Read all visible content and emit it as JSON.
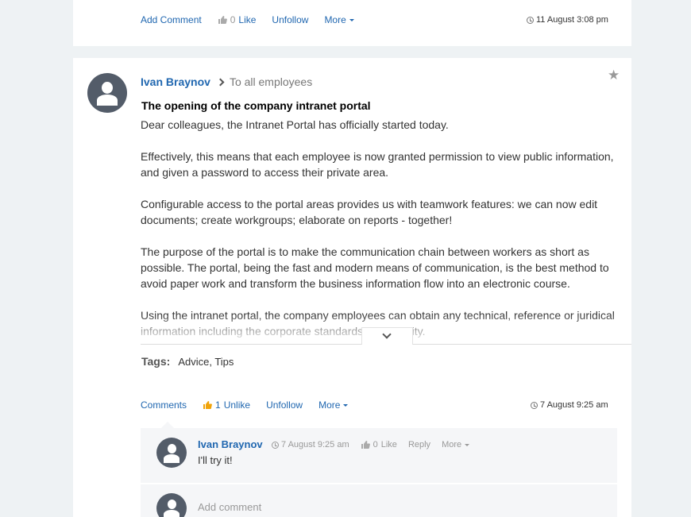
{
  "prev_post": {
    "add_comment": "Add Comment",
    "like_count": "0",
    "like_label": "Like",
    "unfollow": "Unfollow",
    "more": "More",
    "date": "11 August 3:08 pm"
  },
  "post": {
    "author": "Ivan Braynov",
    "recipient": "To all employees",
    "title": "The opening of the company intranet portal",
    "paragraphs": [
      "Dear colleagues, the Intranet Portal has officially started today.",
      "Effectively, this means that each employee is now granted permission to view public information, and given a password to access their private area.",
      "Configurable access to the portal areas provides us with teamwork features: we can now edit documents; create workgroups; elaborate on reports - together!",
      "The purpose of the portal is to make the communication chain between workers as short as possible. The portal, being the fast and modern means of communication, is the best method to avoid paper work and transform the business information flow into an electronic course.",
      "Using the intranet portal, the company employees can obtain any technical, reference or juridical information including the corporate standards and identity."
    ],
    "tags_label": "Tags:",
    "tags": "Advice, Tips",
    "actions": {
      "comments": "Comments",
      "like_count": "1",
      "unlike": "Unlike",
      "unfollow": "Unfollow",
      "more": "More"
    },
    "date": "7 August 9:25 am"
  },
  "comment": {
    "author": "Ivan Braynov",
    "date": "7 August 9:25 am",
    "like_count": "0",
    "like_label": "Like",
    "reply": "Reply",
    "more": "More",
    "text": "I'll try it!"
  },
  "add_comment_placeholder": "Add comment",
  "colors": {
    "link": "#2067b0",
    "avatar": "#535c69",
    "like_active": "#f0a30a",
    "background": "#eef2f4"
  }
}
